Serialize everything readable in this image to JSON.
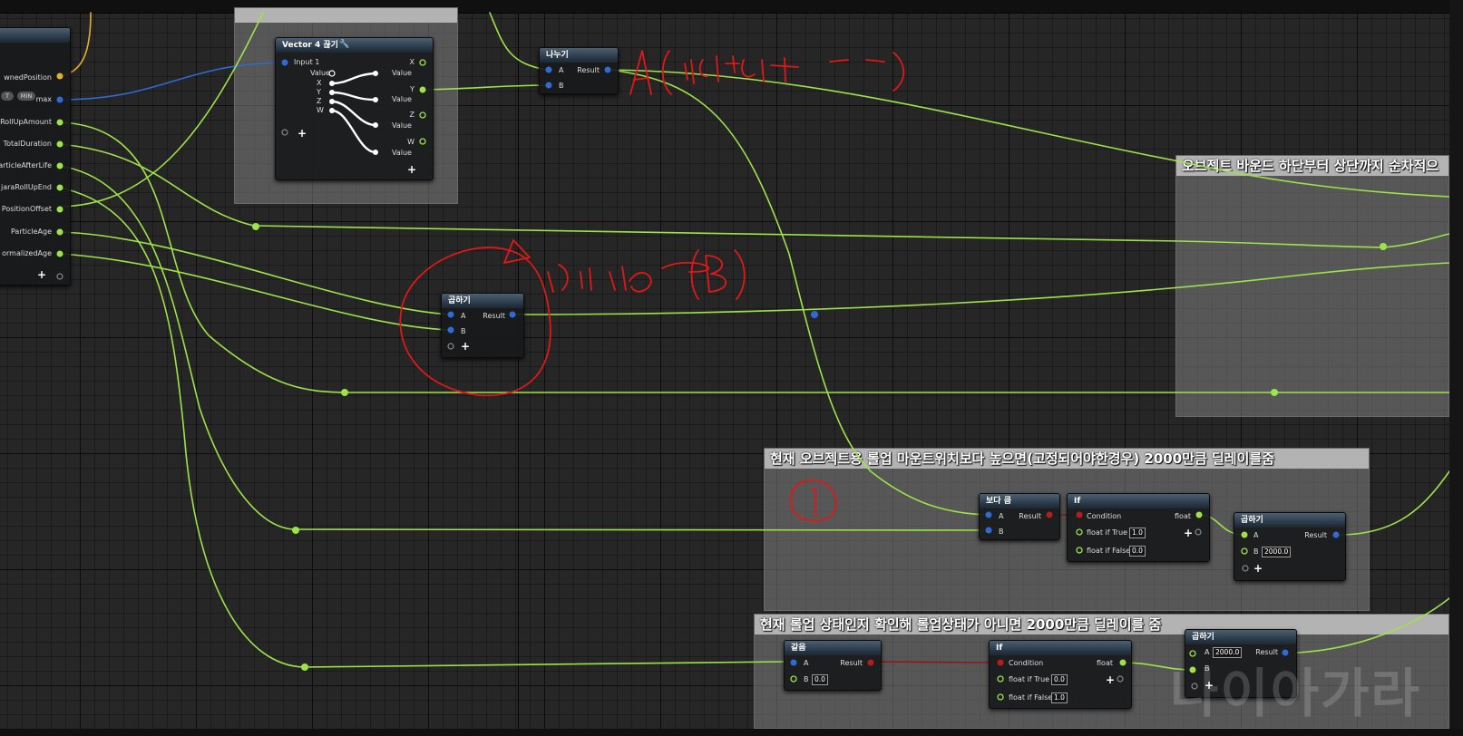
{
  "colors": {
    "float_wire": "#9ee24a",
    "vector_wire": "#2f6bd4",
    "position_wire": "#e0b030",
    "bool_wire": "#8b1a1a",
    "annotation": "#e01818",
    "comment_header": "#b3b3b3",
    "node_header": "#3d4d5d"
  },
  "comments": {
    "top_partial_title": "",
    "object_bounds": "오브젝트 바운드 하단부터 상단까지 순차적으",
    "height_check": "현재 오브젝트용 롤업 마운트위치보다 높으면(고정되어야한경우) 2000만큼 딜레이를줌",
    "rollup_check": "현재 롤업 상태인지 확인해 롤업상태가 아니면 2000만큼 딜레이를 줌"
  },
  "params_node": {
    "pins": [
      "wnedPosition",
      "max",
      "RollUpAmount",
      "TotalDuration",
      "articleAfterLife",
      "jaraRollUpEnd",
      "PositionOffset",
      "ParticleAge",
      "ormalizedAge"
    ],
    "tag_t": "T",
    "tag_min": "MIN"
  },
  "break_vector_node": {
    "title": "Vector 4 끊기",
    "input": "Input 1",
    "value_label": "Value",
    "components": [
      "X",
      "Y",
      "Z",
      "W"
    ],
    "outputs": [
      "X",
      "Y",
      "Z",
      "W"
    ],
    "out_value": "Value"
  },
  "divide_node": {
    "title": "나누기",
    "a": "A",
    "b": "B",
    "result": "Result"
  },
  "multiply_mid_node": {
    "title": "곱하기",
    "a": "A",
    "b": "B",
    "result": "Result"
  },
  "greater_node": {
    "title": "보다 큼",
    "a": "A",
    "b": "B",
    "result": "Result"
  },
  "if_node_1": {
    "title": "If",
    "condition": "Condition",
    "out": "float",
    "true_label": "float if True",
    "true_val": "1.0",
    "false_label": "float if False",
    "false_val": "0.0"
  },
  "multiply_right_node": {
    "title": "곱하기",
    "a": "A",
    "b": "B",
    "b_val": "2000.0",
    "result": "Result"
  },
  "equal_node": {
    "title": "같음",
    "a": "A",
    "b": "B",
    "b_val": "0.0",
    "result": "Result"
  },
  "if_node_2": {
    "title": "If",
    "condition": "Condition",
    "out": "float",
    "true_label": "float if True",
    "true_val": "0.0",
    "false_label": "float if False",
    "false_val": "1.0"
  },
  "multiply_bottom_node": {
    "title": "곱하기",
    "a": "A",
    "a_val": "2000.0",
    "b": "B",
    "result": "Result"
  },
  "watermark": "나이아가라"
}
